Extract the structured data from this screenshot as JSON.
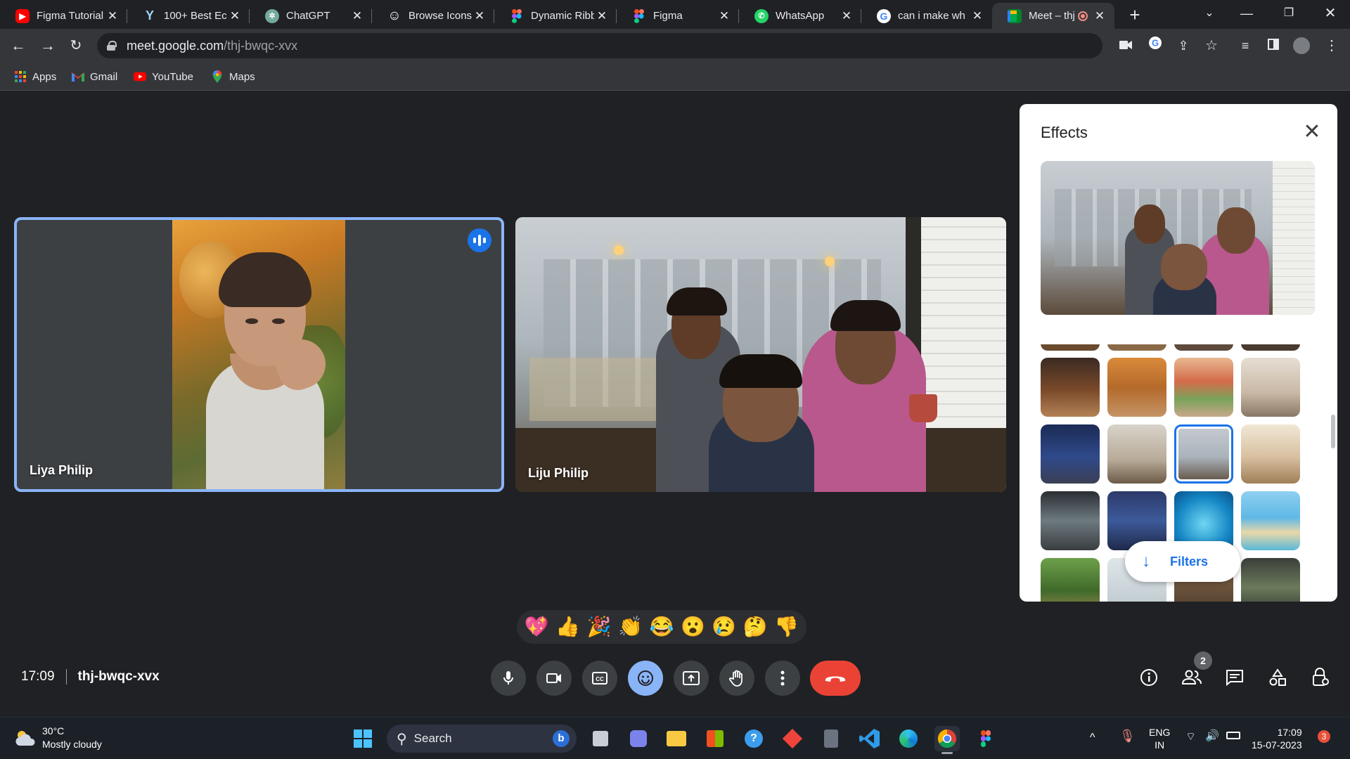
{
  "browser": {
    "tabs": [
      {
        "title": "Figma Tutorial",
        "favicon": "youtube-icon"
      },
      {
        "title": "100+ Best Eco",
        "favicon": "y-icon"
      },
      {
        "title": "ChatGPT",
        "favicon": "chatgpt-icon"
      },
      {
        "title": "Browse Icons -",
        "favicon": "smiley-icon"
      },
      {
        "title": "Dynamic Ribb",
        "favicon": "figma-icon"
      },
      {
        "title": "Figma",
        "favicon": "figma-icon"
      },
      {
        "title": "WhatsApp",
        "favicon": "whatsapp-icon"
      },
      {
        "title": "can i make wh",
        "favicon": "google-icon"
      },
      {
        "title": "Meet – thj",
        "favicon": "meet-icon",
        "active": true
      }
    ],
    "url_host": "meet.google.com",
    "url_path": "/thj-bwqc-xvx",
    "bookmarks": [
      {
        "label": "Apps"
      },
      {
        "label": "Gmail"
      },
      {
        "label": "YouTube"
      },
      {
        "label": "Maps"
      }
    ]
  },
  "meet": {
    "participants": [
      {
        "name": "Liya Philip",
        "speaking": true
      },
      {
        "name": "Liju Philip",
        "speaking": false
      }
    ],
    "effects_panel": {
      "title": "Effects",
      "filters_label": "Filters"
    },
    "reactions": [
      "💖",
      "👍",
      "🎉",
      "👏",
      "😂",
      "😮",
      "😢",
      "🤔",
      "👎"
    ],
    "time": "17:09",
    "meeting_code": "thj-bwqc-xvx",
    "participant_count": "2",
    "accent_color": "#8ab4f8",
    "hangup_color": "#ea4335"
  },
  "taskbar": {
    "temperature": "30°C",
    "weather": "Mostly cloudy",
    "search_label": "Search",
    "lang_line1": "ENG",
    "lang_line2": "IN",
    "time": "17:09",
    "date": "15-07-2023",
    "notification_count": "3"
  }
}
